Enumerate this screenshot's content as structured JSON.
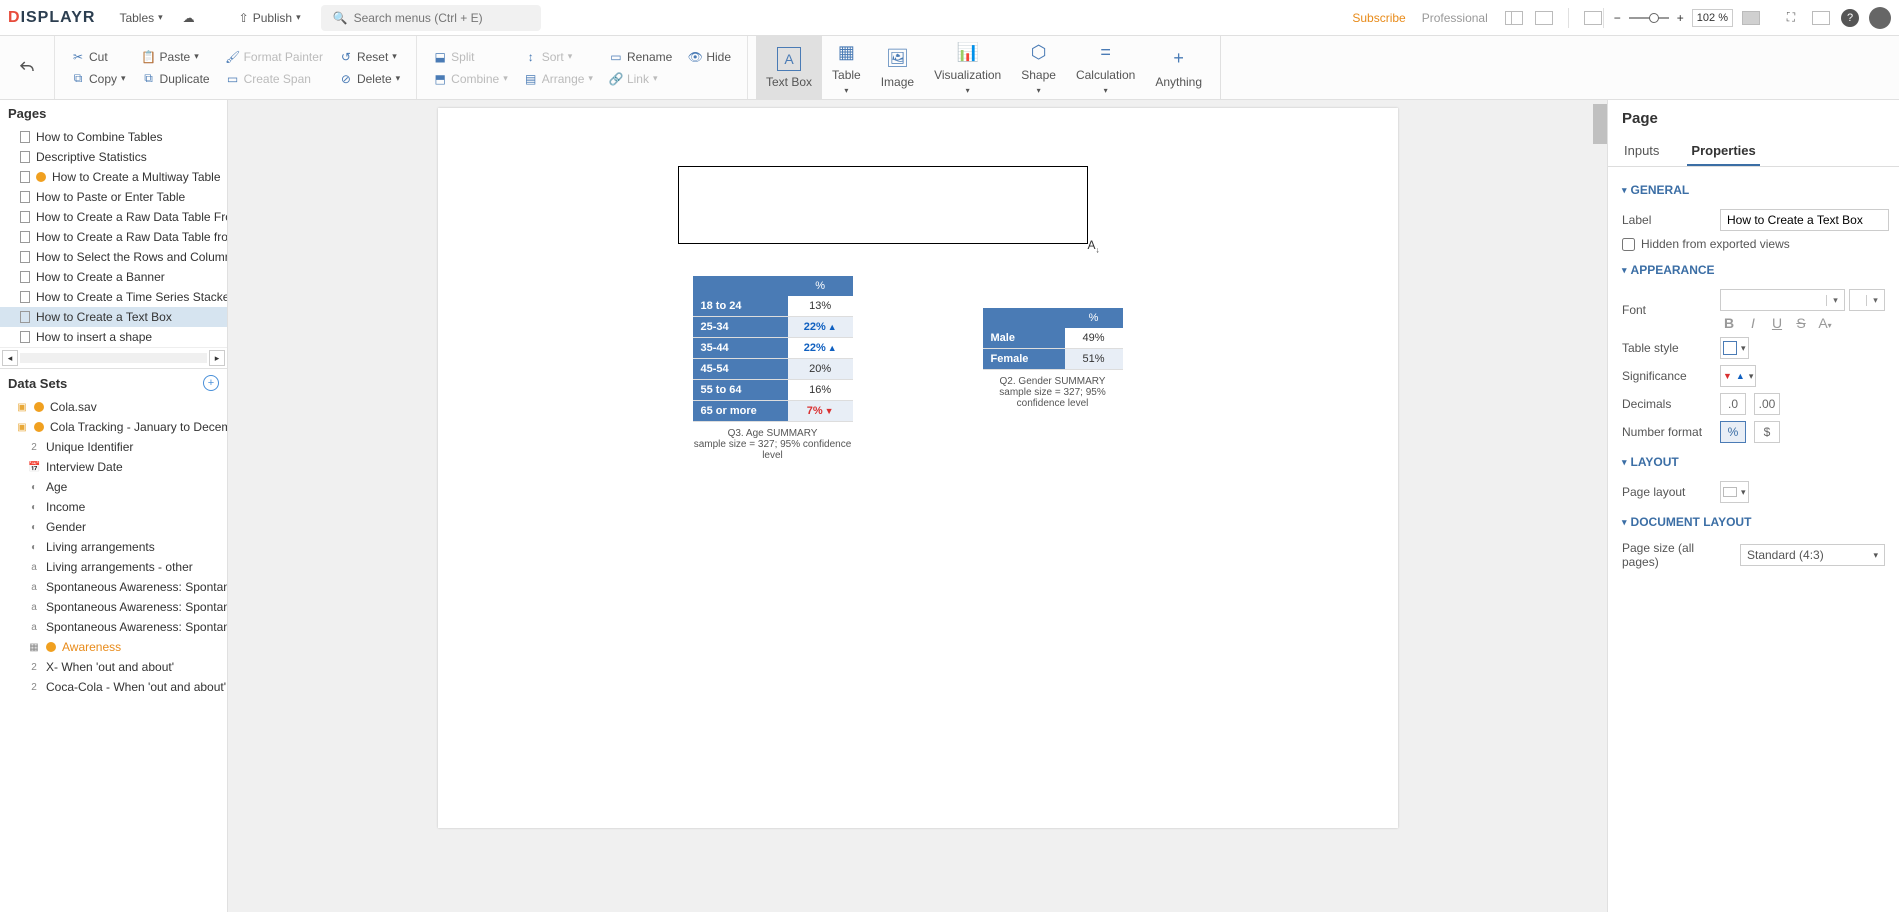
{
  "app": {
    "logo_left": "D",
    "logo_rest": "ISPLAYR"
  },
  "topbar": {
    "tables": "Tables",
    "publish": "Publish",
    "search_placeholder": "Search menus (Ctrl + E)",
    "subscribe": "Subscribe",
    "plan": "Professional",
    "zoom": "102 %"
  },
  "ribbon": {
    "cut": "Cut",
    "copy": "Copy",
    "paste": "Paste",
    "format_painter": "Format Painter",
    "reset": "Reset",
    "duplicate": "Duplicate",
    "delete": "Delete",
    "create_span": "Create Span",
    "split": "Split",
    "combine": "Combine",
    "sort": "Sort",
    "arrange": "Arrange",
    "rename": "Rename",
    "hide": "Hide",
    "link": "Link",
    "text_box": "Text Box",
    "table": "Table",
    "image": "Image",
    "visualization": "Visualization",
    "shape": "Shape",
    "calculation": "Calculation",
    "anything": "Anything"
  },
  "pages": {
    "header": "Pages",
    "items": [
      "How to Combine Tables",
      "Descriptive Statistics",
      "How to Create a Multiway Table",
      "How to Paste or Enter Table",
      "How to Create a Raw Data Table From a V",
      "How to Create a Raw Data Table from Var",
      "How to Select the Rows and Columns to A",
      "How to Create a Banner",
      "How to Create a Time Series Stacked by Y",
      "How to Create a Text Box",
      "How to insert a shape"
    ],
    "warn_index": 2,
    "active_index": 9
  },
  "datasets": {
    "header": "Data Sets",
    "items": [
      {
        "t": "Cola.sav",
        "lv": 1,
        "icon": "db",
        "warn": true
      },
      {
        "t": "Cola Tracking - January to December.",
        "lv": 1,
        "icon": "db",
        "warn": true
      },
      {
        "t": "Unique Identifier",
        "lv": 2,
        "icon": "2"
      },
      {
        "t": "Interview Date",
        "lv": 2,
        "icon": "cal"
      },
      {
        "t": "Age",
        "lv": 2,
        "icon": "g"
      },
      {
        "t": "Income",
        "lv": 2,
        "icon": "g"
      },
      {
        "t": "Gender",
        "lv": 2,
        "icon": "g"
      },
      {
        "t": "Living arrangements",
        "lv": 2,
        "icon": "g"
      },
      {
        "t": "Living arrangements - other",
        "lv": 2,
        "icon": "a"
      },
      {
        "t": "Spontaneous Awareness: Spontaneous",
        "lv": 2,
        "icon": "a"
      },
      {
        "t": "Spontaneous Awareness: Spontaneous",
        "lv": 2,
        "icon": "a"
      },
      {
        "t": "Spontaneous Awareness: Spontaneous",
        "lv": 2,
        "icon": "a"
      },
      {
        "t": "Awareness",
        "lv": 2,
        "icon": "grid",
        "highlight": true,
        "warn": true
      },
      {
        "t": "X- When 'out and about'",
        "lv": 2,
        "icon": "2"
      },
      {
        "t": "Coca-Cola - When 'out and about'",
        "lv": 2,
        "icon": "2"
      }
    ]
  },
  "chart_data": [
    {
      "type": "table",
      "title": "Q3. Age SUMMARY",
      "subtitle": "sample size = 327; 95% confidence level",
      "header": "%",
      "rows": [
        {
          "label": "18 to 24",
          "value": "13%",
          "sig": ""
        },
        {
          "label": "25-34",
          "value": "22%",
          "sig": "up"
        },
        {
          "label": "35-44",
          "value": "22%",
          "sig": "up"
        },
        {
          "label": "45-54",
          "value": "20%",
          "sig": ""
        },
        {
          "label": "55 to 64",
          "value": "16%",
          "sig": ""
        },
        {
          "label": "65 or more",
          "value": "7%",
          "sig": "down"
        }
      ]
    },
    {
      "type": "table",
      "title": "Q2. Gender SUMMARY",
      "subtitle": "sample size = 327; 95% confidence level",
      "header": "%",
      "rows": [
        {
          "label": "Male",
          "value": "49%",
          "sig": ""
        },
        {
          "label": "Female",
          "value": "51%",
          "sig": ""
        }
      ]
    }
  ],
  "right": {
    "title": "Page",
    "tab_inputs": "Inputs",
    "tab_properties": "Properties",
    "general": "GENERAL",
    "label": "Label",
    "label_value": "How to Create a Text Box",
    "hidden": "Hidden from exported views",
    "appearance": "APPEARANCE",
    "font": "Font",
    "table_style": "Table style",
    "significance": "Significance",
    "decimals": "Decimals",
    "number_format": "Number format",
    "layout": "LAYOUT",
    "page_layout": "Page layout",
    "doc_layout": "DOCUMENT LAYOUT",
    "page_size": "Page size (all pages)",
    "page_size_value": "Standard (4:3)"
  }
}
